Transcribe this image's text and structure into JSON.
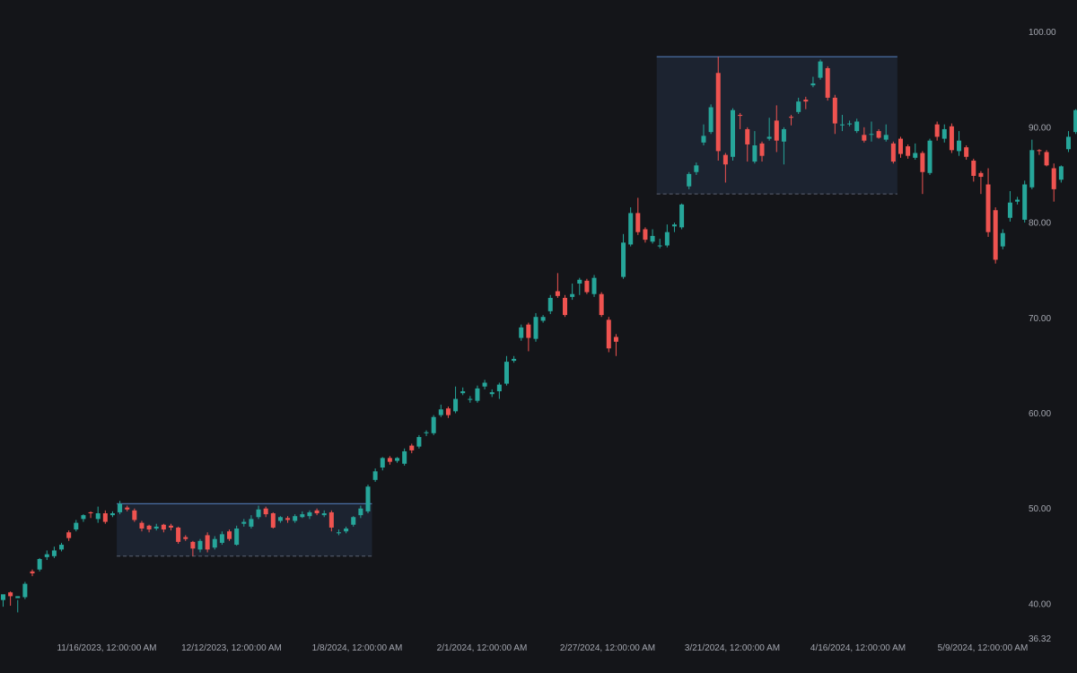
{
  "chart_data": {
    "type": "candlestick",
    "y_axis": {
      "ticks": [
        40,
        50,
        60,
        70,
        80,
        90,
        100
      ],
      "tick_labels": [
        "40.00",
        "50.00",
        "60.00",
        "70.00",
        "80.00",
        "90.00",
        "100.00"
      ],
      "min_label": "36.32",
      "range": [
        36.32,
        102.6
      ],
      "position": "right"
    },
    "x_axis": {
      "tick_labels": [
        "11/16/2023, 12:00:00 AM",
        "12/12/2023, 12:00:00 AM",
        "1/8/2024, 12:00:00 AM",
        "2/1/2024, 12:00:00 AM",
        "2/27/2024, 12:00:00 AM",
        "3/21/2024, 12:00:00 AM",
        "4/16/2024, 12:00:00 AM",
        "5/9/2024, 12:00:00 AM"
      ]
    },
    "grid": false,
    "colors": {
      "background": "#141519",
      "up": "#26a69a",
      "down": "#ef5350",
      "box_fill": "#1c2330",
      "box_top": "#4a6fa5",
      "box_bottom": "#5a6272",
      "text": "#a3a6af"
    },
    "zones": [
      {
        "start_index": 16,
        "end_index": 50,
        "high": 50.5,
        "low": 45.0
      },
      {
        "start_index": 90,
        "end_index": 122,
        "high": 97.4,
        "low": 83.0
      }
    ],
    "candles": [
      [
        40.4,
        41.0,
        39.7,
        40.9
      ],
      [
        41.2,
        40.8,
        41.3,
        39.8
      ],
      [
        40.6,
        40.8,
        39.1,
        40.4
      ],
      [
        40.7,
        42.1,
        40.5,
        42.3
      ],
      [
        43.4,
        43.2,
        43.6,
        42.9
      ],
      [
        43.6,
        44.7,
        43.4,
        44.8
      ],
      [
        44.9,
        45.2,
        44.6,
        45.6
      ],
      [
        45.0,
        45.6,
        44.8,
        46.0
      ],
      [
        45.7,
        46.2,
        45.5,
        46.4
      ],
      [
        47.5,
        46.9,
        47.7,
        46.6
      ],
      [
        47.8,
        48.5,
        47.6,
        48.8
      ],
      [
        48.9,
        49.3,
        48.6,
        49.4
      ],
      [
        49.6,
        49.5,
        49.7,
        49.0
      ],
      [
        48.9,
        49.5,
        48.5,
        50.2
      ],
      [
        49.5,
        48.6,
        49.8,
        48.4
      ],
      [
        49.3,
        49.5,
        49.1,
        49.7
      ],
      [
        49.6,
        50.5,
        49.4,
        50.8
      ],
      [
        50.1,
        49.9,
        50.3,
        49.7
      ],
      [
        49.8,
        48.8,
        50.0,
        48.6
      ],
      [
        48.5,
        47.9,
        48.7,
        47.6
      ],
      [
        48.2,
        47.8,
        48.3,
        47.5
      ],
      [
        47.9,
        48.1,
        47.7,
        48.4
      ],
      [
        48.3,
        47.8,
        48.4,
        47.5
      ],
      [
        48.2,
        48.0,
        48.4,
        47.7
      ],
      [
        48.0,
        46.5,
        48.1,
        46.3
      ],
      [
        47.0,
        46.8,
        47.2,
        46.6
      ],
      [
        46.5,
        45.8,
        46.6,
        45.0
      ],
      [
        45.7,
        46.6,
        45.4,
        46.8
      ],
      [
        47.2,
        45.7,
        47.5,
        45.4
      ],
      [
        45.9,
        46.8,
        45.7,
        47.1
      ],
      [
        46.4,
        47.3,
        46.2,
        47.6
      ],
      [
        47.6,
        46.8,
        47.8,
        46.6
      ],
      [
        46.2,
        47.9,
        46.1,
        48.2
      ],
      [
        48.4,
        48.6,
        48.1,
        48.9
      ],
      [
        48.1,
        48.9,
        47.9,
        49.3
      ],
      [
        49.1,
        49.9,
        48.9,
        50.3
      ],
      [
        50.0,
        49.4,
        50.2,
        49.1
      ],
      [
        49.5,
        48.0,
        49.6,
        47.9
      ],
      [
        48.7,
        49.1,
        48.5,
        49.2
      ],
      [
        49.0,
        48.8,
        49.2,
        48.5
      ],
      [
        48.7,
        49.2,
        48.5,
        49.4
      ],
      [
        49.1,
        49.4,
        49.0,
        49.7
      ],
      [
        49.2,
        49.6,
        48.9,
        49.8
      ],
      [
        49.8,
        49.5,
        50.0,
        49.3
      ],
      [
        49.3,
        49.5,
        49.1,
        49.8
      ],
      [
        49.6,
        48.0,
        49.8,
        47.6
      ],
      [
        47.4,
        47.5,
        47.2,
        47.8
      ],
      [
        47.6,
        47.9,
        47.4,
        48.1
      ],
      [
        48.3,
        49.1,
        48.1,
        49.2
      ],
      [
        49.3,
        50.0,
        49.0,
        50.3
      ],
      [
        49.7,
        52.3,
        49.5,
        52.5
      ],
      [
        53.0,
        53.9,
        52.8,
        54.2
      ],
      [
        54.3,
        55.3,
        54.0,
        55.4
      ],
      [
        55.3,
        54.9,
        55.5,
        54.6
      ],
      [
        55.0,
        55.3,
        54.8,
        55.4
      ],
      [
        54.7,
        56.0,
        54.5,
        56.3
      ],
      [
        56.6,
        56.1,
        56.8,
        55.8
      ],
      [
        56.5,
        57.5,
        56.3,
        57.7
      ],
      [
        57.9,
        58.0,
        57.6,
        58.2
      ],
      [
        57.9,
        59.6,
        57.7,
        59.8
      ],
      [
        59.8,
        60.4,
        59.6,
        60.9
      ],
      [
        60.5,
        59.8,
        60.7,
        59.5
      ],
      [
        60.2,
        61.5,
        60.0,
        62.8
      ],
      [
        62.1,
        62.3,
        61.9,
        62.7
      ],
      [
        61.4,
        61.5,
        61.1,
        61.8
      ],
      [
        61.3,
        62.6,
        61.1,
        62.9
      ],
      [
        62.8,
        63.2,
        62.5,
        63.5
      ],
      [
        62.0,
        62.2,
        61.7,
        62.5
      ],
      [
        62.3,
        63.0,
        61.5,
        63.2
      ],
      [
        63.1,
        65.4,
        62.9,
        66.0
      ],
      [
        65.5,
        65.7,
        65.3,
        66.0
      ],
      [
        67.9,
        69.0,
        67.6,
        69.3
      ],
      [
        69.3,
        67.9,
        69.5,
        66.5
      ],
      [
        67.8,
        70.1,
        67.5,
        70.5
      ],
      [
        69.7,
        70.1,
        69.5,
        70.3
      ],
      [
        70.7,
        72.1,
        70.4,
        72.4
      ],
      [
        72.8,
        72.3,
        74.7,
        72.1
      ],
      [
        72.1,
        70.3,
        72.4,
        70.1
      ],
      [
        72.2,
        72.5,
        71.9,
        73.6
      ],
      [
        73.6,
        74.0,
        72.4,
        74.2
      ],
      [
        73.9,
        72.7,
        74.1,
        72.5
      ],
      [
        72.5,
        74.2,
        72.2,
        74.5
      ],
      [
        72.5,
        70.3,
        72.7,
        70.1
      ],
      [
        69.8,
        66.8,
        70.1,
        66.4
      ],
      [
        68.0,
        67.5,
        68.3,
        66.0
      ],
      [
        74.3,
        77.9,
        74.1,
        78.8
      ],
      [
        77.7,
        81.0,
        77.5,
        81.6
      ],
      [
        81.0,
        79.0,
        82.6,
        78.7
      ],
      [
        79.3,
        78.2,
        79.5,
        77.9
      ],
      [
        78.0,
        78.6,
        77.8,
        79.3
      ],
      [
        77.6,
        77.6,
        77.3,
        78.3
      ],
      [
        77.6,
        79.0,
        77.4,
        79.8
      ],
      [
        79.6,
        79.8,
        79.0,
        80.0
      ],
      [
        79.5,
        81.9,
        79.3,
        82.0
      ],
      [
        83.8,
        85.1,
        83.5,
        85.3
      ],
      [
        85.3,
        86.0,
        85.0,
        86.3
      ],
      [
        88.4,
        89.1,
        88.1,
        90.3
      ],
      [
        89.5,
        92.1,
        89.3,
        92.4
      ],
      [
        95.7,
        87.5,
        97.4,
        86.5
      ],
      [
        87.1,
        86.1,
        87.3,
        84.2
      ],
      [
        86.9,
        91.8,
        86.5,
        92.0
      ],
      [
        91.3,
        91.2,
        91.5,
        89.8
      ],
      [
        89.8,
        88.2,
        90.0,
        86.4
      ],
      [
        86.4,
        88.1,
        86.2,
        89.6
      ],
      [
        88.3,
        87.0,
        88.5,
        86.4
      ],
      [
        88.8,
        89.0,
        88.6,
        91.0
      ],
      [
        90.7,
        88.6,
        92.3,
        87.4
      ],
      [
        88.5,
        89.8,
        86.1,
        90.0
      ],
      [
        91.1,
        91.0,
        91.3,
        90.2
      ],
      [
        91.6,
        92.7,
        91.4,
        93.1
      ],
      [
        92.9,
        92.7,
        93.2,
        91.9
      ],
      [
        94.4,
        94.6,
        94.2,
        95.3
      ],
      [
        95.2,
        96.9,
        95.0,
        97.1
      ],
      [
        96.2,
        93.1,
        96.4,
        92.8
      ],
      [
        93.1,
        90.4,
        93.4,
        89.3
      ],
      [
        90.2,
        90.3,
        89.6,
        91.3
      ],
      [
        90.3,
        90.4,
        90.1,
        90.7
      ],
      [
        89.6,
        90.6,
        89.4,
        90.9
      ],
      [
        89.2,
        88.6,
        90.0,
        88.4
      ],
      [
        89.3,
        89.3,
        88.5,
        90.6
      ],
      [
        89.6,
        88.9,
        89.8,
        88.8
      ],
      [
        88.7,
        89.2,
        88.5,
        90.3
      ],
      [
        88.3,
        86.4,
        88.5,
        86.2
      ],
      [
        88.8,
        87.2,
        89.0,
        86.8
      ],
      [
        88.0,
        87.0,
        88.2,
        86.7
      ],
      [
        86.8,
        87.3,
        86.6,
        88.3
      ],
      [
        87.3,
        85.3,
        87.5,
        83.0
      ],
      [
        85.2,
        88.6,
        85.0,
        88.8
      ],
      [
        90.3,
        89.0,
        90.6,
        88.6
      ],
      [
        88.8,
        89.8,
        88.4,
        90.3
      ],
      [
        90.1,
        87.6,
        90.4,
        87.3
      ],
      [
        87.5,
        88.6,
        87.0,
        89.6
      ],
      [
        87.9,
        86.9,
        88.1,
        86.6
      ],
      [
        86.5,
        84.9,
        86.7,
        84.3
      ],
      [
        85.2,
        84.8,
        85.4,
        83.0
      ],
      [
        84.0,
        79.0,
        85.7,
        78.5
      ],
      [
        81.3,
        76.1,
        81.6,
        75.7
      ],
      [
        77.5,
        78.9,
        77.2,
        79.3
      ],
      [
        80.5,
        82.1,
        80.1,
        83.3
      ],
      [
        82.2,
        82.4,
        81.9,
        82.7
      ],
      [
        80.3,
        84.0,
        80.0,
        84.4
      ],
      [
        83.7,
        87.6,
        83.5,
        88.7
      ],
      [
        87.6,
        87.5,
        87.7,
        87.1
      ],
      [
        87.4,
        86.0,
        87.6,
        85.9
      ],
      [
        85.7,
        83.5,
        86.2,
        82.2
      ],
      [
        84.5,
        85.9,
        84.2,
        86.0
      ],
      [
        87.7,
        89.0,
        87.4,
        89.6
      ],
      [
        89.5,
        91.8,
        89.3,
        91.9
      ],
      [
        91.4,
        90.6,
        91.6,
        90.1
      ],
      [
        90.2,
        90.3,
        89.9,
        90.6
      ],
      [
        91.0,
        90.6,
        91.2,
        90.2
      ],
      [
        90.6,
        88.9,
        90.8,
        88.6
      ],
      [
        90.1,
        89.6,
        90.4,
        89.4
      ],
      [
        89.7,
        90.6,
        89.5,
        91.0
      ],
      [
        89.4,
        91.1,
        89.2,
        91.5
      ],
      [
        92.4,
        94.5,
        92.2,
        94.9
      ],
      [
        95.1,
        94.3,
        95.7,
        94.1
      ]
    ]
  }
}
